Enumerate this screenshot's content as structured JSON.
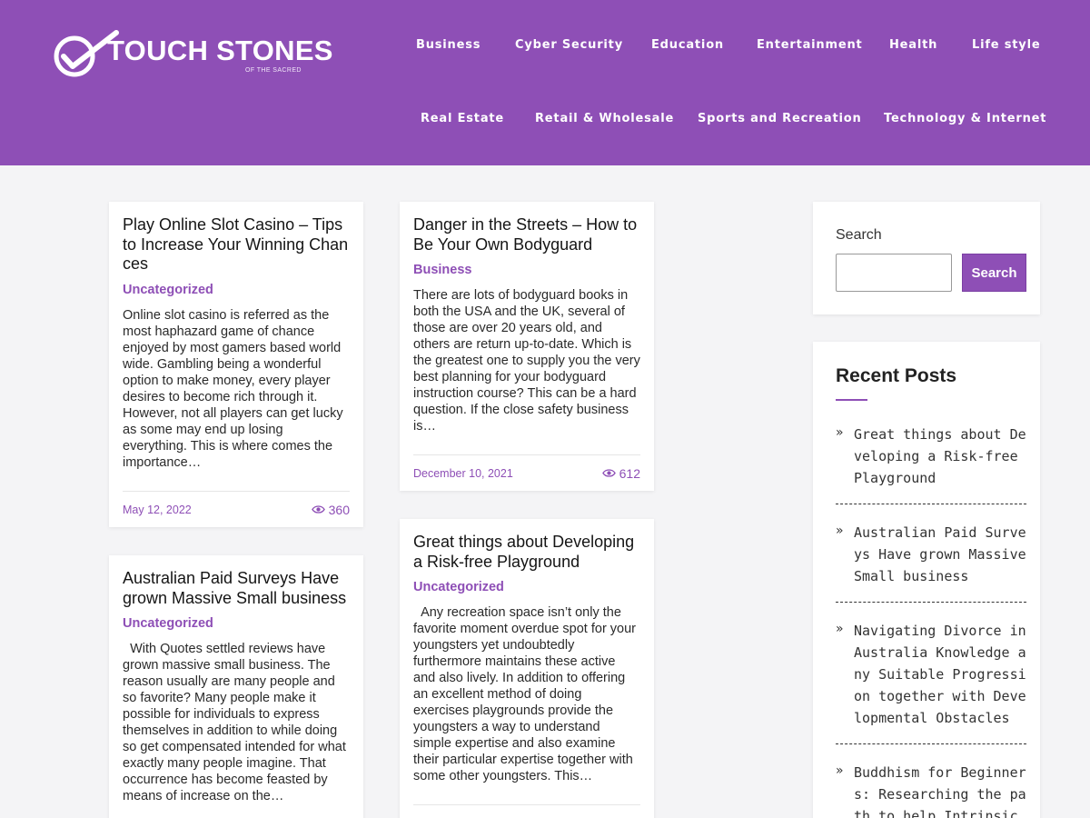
{
  "site": {
    "logo_main": "TOUCH STONES",
    "logo_sub": "OF THE SACRED"
  },
  "nav": {
    "row1": [
      "Business",
      "Cyber Security",
      "Education",
      "Entertainment",
      "Health",
      "Life style"
    ],
    "row2": [
      "Real Estate",
      "Retail & Wholesale",
      "Sports and Recreation",
      "Technology & Internet"
    ]
  },
  "posts": [
    {
      "title": "Play Online Slot Casino – Tips to Increase Your Winning Chances",
      "category": "Uncategorized",
      "excerpt": "Online slot casino is referred as the most haphazard game of chance enjoyed by most gamers based world wide. Gambling being a wonderful option to make money, every player desires to become rich through it. However, not all players can get lucky as some may end up losing everything. This is where comes the importance…",
      "date": "May 12, 2022",
      "views": "360"
    },
    {
      "title": "Danger in the Streets – How to Be Your Own Bodyguard",
      "category": "Business",
      "excerpt": "There are lots of bodyguard books in both the USA and the UK, several of those are over 20 years old, and others are return up-to-date. Which is the greatest one to supply you the very best planning for your bodyguard instruction course? This can be a hard question. If the close safety business is…",
      "date": "December 10, 2021",
      "views": "612"
    },
    {
      "title": "Australian Paid Surveys Have grown Massive Small business",
      "category": "Uncategorized",
      "excerpt": "  With Quotes settled reviews have grown massive small business. The reason usually are many people and so favorite? Many people make it possible for individuals to express themselves in addition to while doing so get compensated intended for what exactly many people imagine. That occurrence has become feasted by means of increase on the…",
      "date": "",
      "views": ""
    },
    {
      "title": "Great things about Developing a Risk-free Playground",
      "category": "Uncategorized",
      "excerpt": "  Any recreation space isn’t only the favorite moment overdue spot for your youngsters yet undoubtedly furthermore maintains these active and also lively. In addition to offering an excellent method of doing exercises playgrounds provide the youngsters a way to understand simple expertise and also examine their particular expertise together with some other youngsters. This…",
      "date": "",
      "views": ""
    }
  ],
  "sidebar": {
    "search_label": "Search",
    "search_value": "",
    "search_button": "Search",
    "recent_title": "Recent Posts",
    "recent_posts": [
      "Great things about Developing a Risk-free Playground",
      "Australian Paid Surveys Have grown Massive Small business",
      "Navigating Divorce in Australia Knowledge any Suitable Progression together with Developmental Obstacles",
      "Buddhism for Beginners: Researching the path to help Intrinsic Contentment"
    ]
  },
  "colors": {
    "brand": "#8e4fb6",
    "background": "#f4f4f6"
  }
}
